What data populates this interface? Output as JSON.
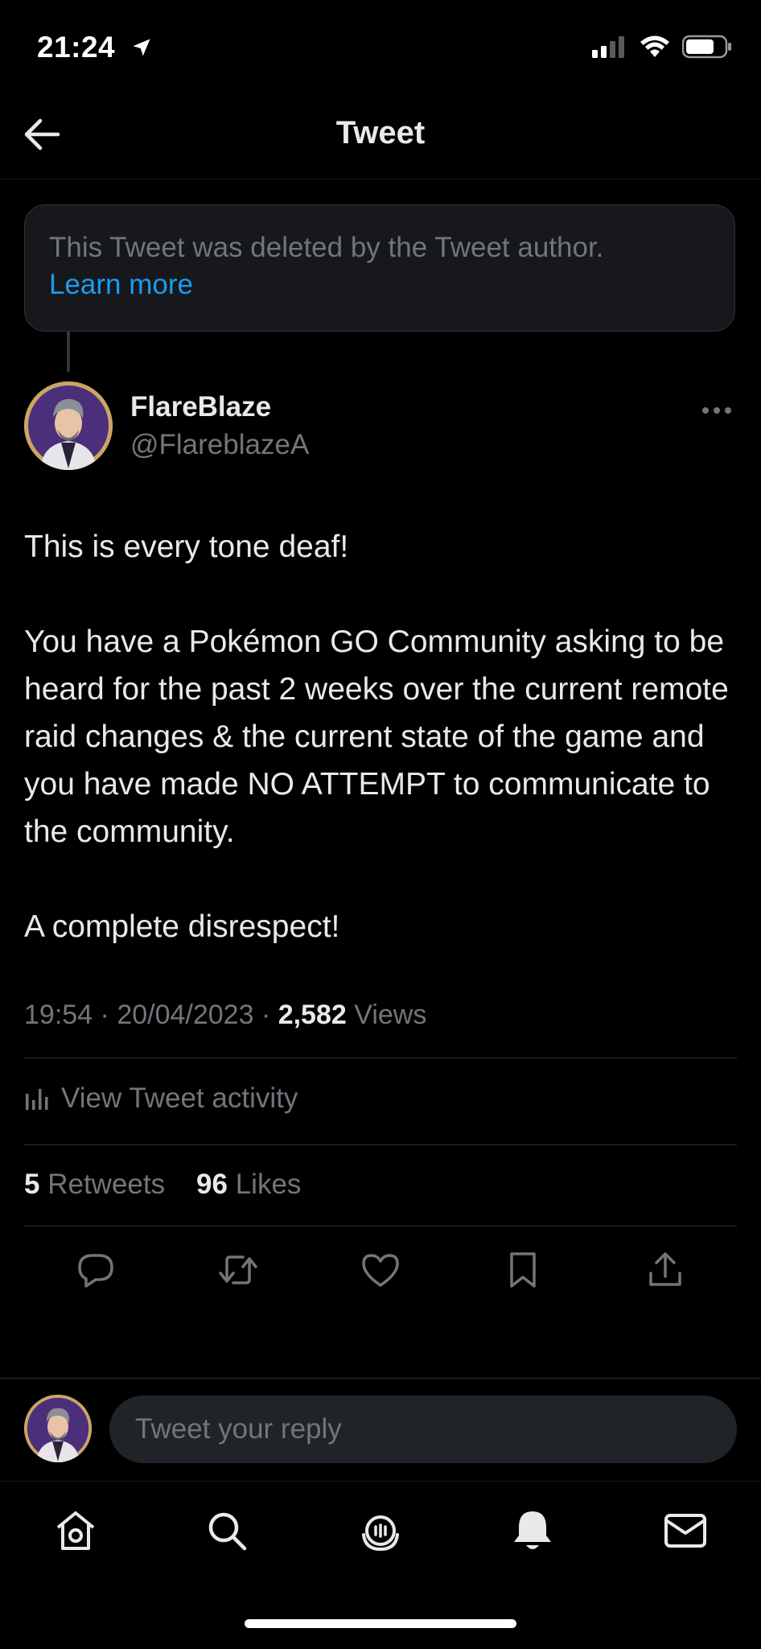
{
  "status_bar": {
    "time": "21:24"
  },
  "header": {
    "title": "Tweet"
  },
  "deleted_notice": {
    "text": "This Tweet was deleted by the Tweet author.",
    "link": "Learn more"
  },
  "tweet": {
    "author_name": "FlareBlaze",
    "author_handle": "@FlareblazeA",
    "body": [
      "This is every tone deaf!",
      "You have a Pokémon GO Community asking to be heard for the past 2 weeks over the current remote raid changes & the current state of the game and you have made NO ATTEMPT to communicate to the community.",
      "A complete disrespect!"
    ],
    "time": "19:54",
    "date": "20/04/2023",
    "views_count": "2,582",
    "views_label": "Views",
    "activity_label": "View Tweet activity",
    "retweets_count": "5",
    "retweets_label": "Retweets",
    "likes_count": "96",
    "likes_label": "Likes"
  },
  "reply": {
    "placeholder": "Tweet your reply"
  },
  "colors": {
    "background": "#000000",
    "accent": "#1d9bf0",
    "text": "#e7e9ea",
    "muted": "#71767b"
  },
  "icons": [
    "back-arrow-icon",
    "more-icon",
    "analytics-icon",
    "reply-icon",
    "retweet-icon",
    "like-icon",
    "bookmark-icon",
    "share-icon",
    "home-icon",
    "search-icon",
    "spaces-icon",
    "notifications-icon",
    "messages-icon"
  ]
}
